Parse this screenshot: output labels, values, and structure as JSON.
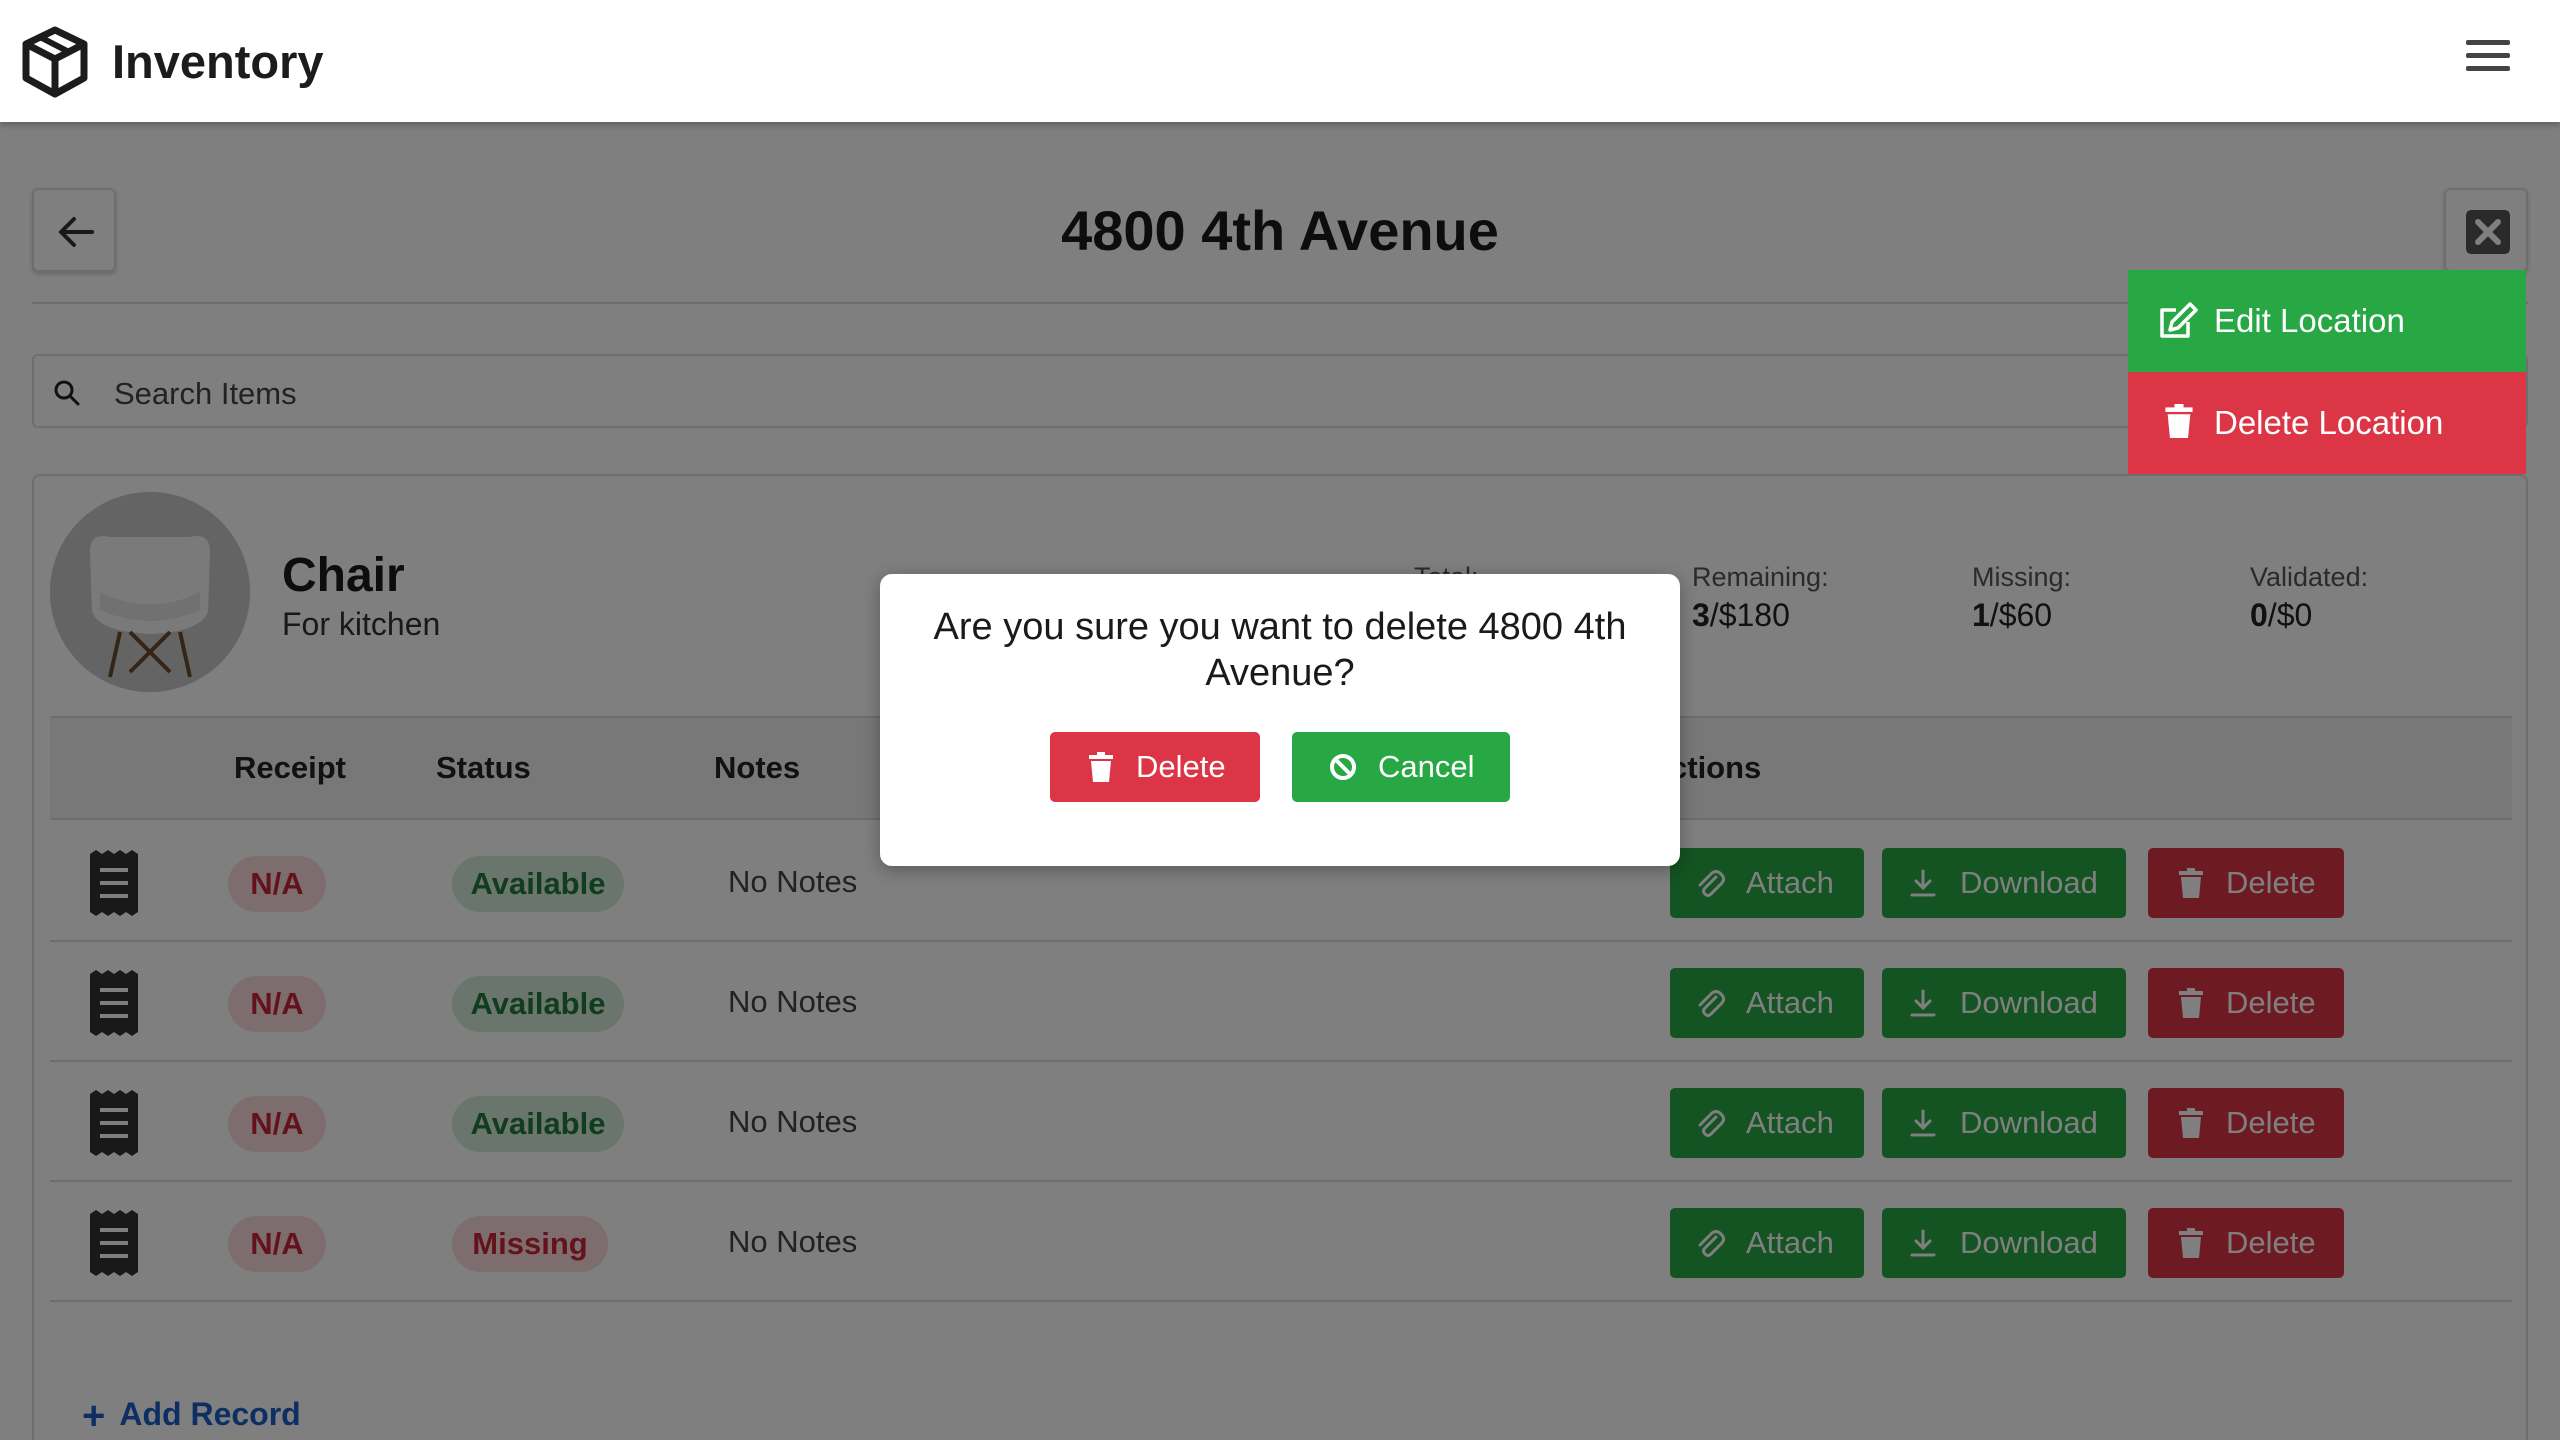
{
  "app": {
    "title": "Inventory"
  },
  "page": {
    "title": "4800 4th Avenue",
    "search_placeholder": "Search Items"
  },
  "menu": {
    "edit_label": "Edit Location",
    "delete_label": "Delete Location"
  },
  "item": {
    "name": "Chair",
    "description": "For kitchen",
    "stats": {
      "total_label": "Total:",
      "remaining_label": "Remaining:",
      "remaining_count": "3",
      "remaining_value": "/$180",
      "missing_label": "Missing:",
      "missing_count": "1",
      "missing_value": "/$60",
      "validated_label": "Validated:",
      "validated_count": "0",
      "validated_value": "/$0"
    }
  },
  "table": {
    "headers": {
      "receipt": "Receipt",
      "status": "Status",
      "notes": "Notes",
      "actions": "ctions"
    },
    "rows": [
      {
        "receipt": "N/A",
        "status": "Available",
        "notes": "No Notes"
      },
      {
        "receipt": "N/A",
        "status": "Available",
        "notes": "No Notes"
      },
      {
        "receipt": "N/A",
        "status": "Available",
        "notes": "No Notes"
      },
      {
        "receipt": "N/A",
        "status": "Missing",
        "notes": "No Notes"
      }
    ],
    "actions": {
      "attach": "Attach",
      "download": "Download",
      "delete": "Delete"
    },
    "add_record": "Add Record"
  },
  "modal": {
    "message": "Are you sure you want to delete 4800 4th Avenue?",
    "delete_label": "Delete",
    "cancel_label": "Cancel"
  },
  "colors": {
    "success": "#28a745",
    "danger": "#dc3545",
    "link": "#1a5fc9"
  },
  "icons": [
    "box-icon",
    "hamburger-icon",
    "arrow-left-icon",
    "close-x-icon",
    "search-icon",
    "edit-icon",
    "trash-icon",
    "receipt-icon",
    "paperclip-icon",
    "download-icon",
    "plus-icon",
    "ban-icon"
  ]
}
